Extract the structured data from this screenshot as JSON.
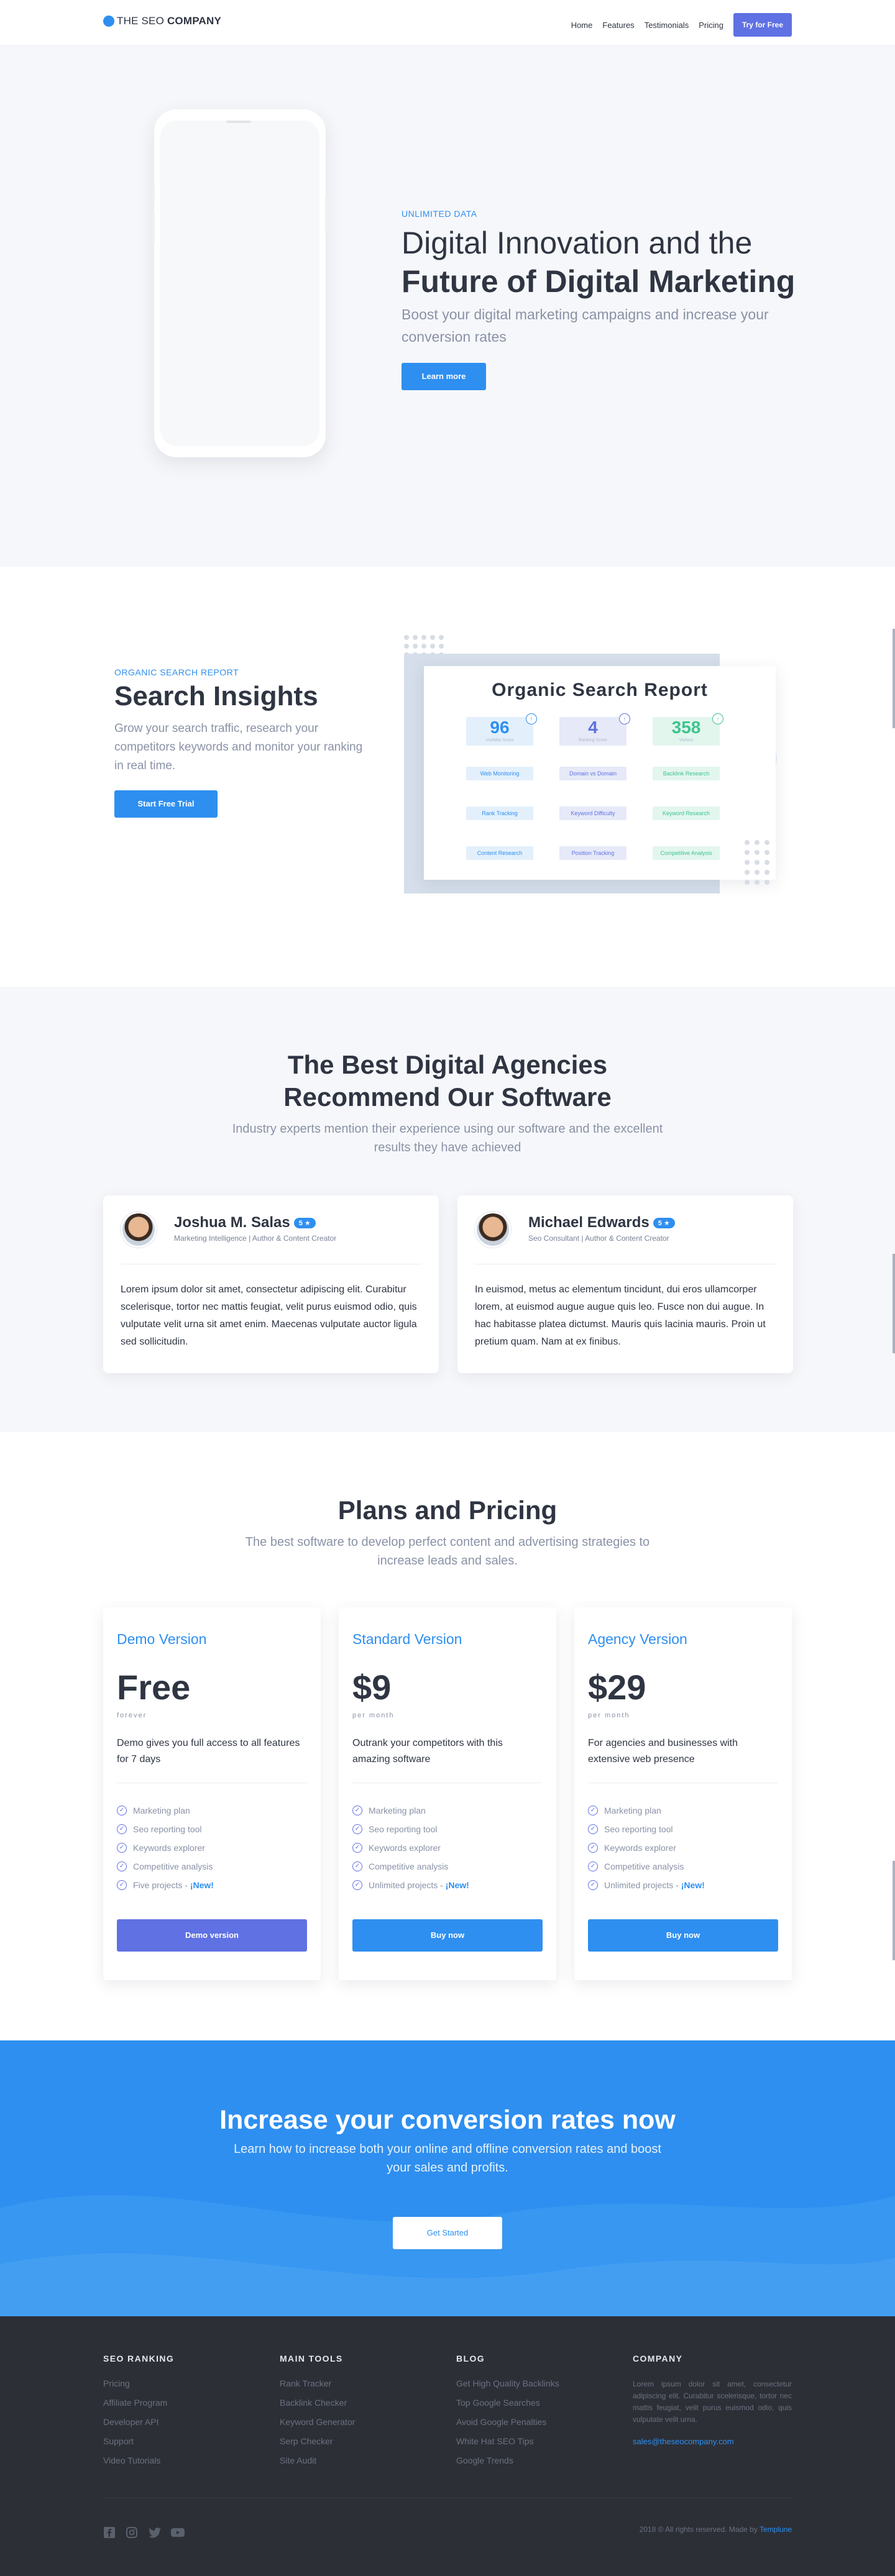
{
  "nav": {
    "logo_pre": "THE SEO ",
    "logo_bold": "COMPANY",
    "links": [
      "Home",
      "Features",
      "Testimonials",
      "Pricing"
    ],
    "cta": "Try for Free"
  },
  "hero": {
    "eyebrow": "UNLIMITED DATA",
    "title_light": "Digital Innovation and the",
    "title_bold": "Future of Digital Marketing",
    "subtitle": "Boost your digital marketing campaigns and increase your conversion rates",
    "button": "Learn more"
  },
  "insights": {
    "eyebrow": "ORGANIC SEARCH REPORT",
    "title": "Search Insights",
    "subtitle": "Grow your search traffic, research your competitors keywords and monitor your ranking in real time.",
    "button": "Start Free Trial",
    "report": {
      "title": "Organic Search Report",
      "stats": [
        {
          "value": "96",
          "label": "Visibility Score",
          "color": "#2e8ff0"
        },
        {
          "value": "4",
          "label": "Ranking Score",
          "color": "#5f71e3"
        },
        {
          "value": "358",
          "label": "Visitors",
          "color": "#3ec48e"
        }
      ],
      "chips": [
        "Web Monitoring",
        "Domain vs Domain",
        "Backlink Research",
        "Rank Tracking",
        "Keyword Difficulty",
        "Keyword Research",
        "Content Research",
        "Position Tracking",
        "Competitive Analysis"
      ]
    }
  },
  "testimonials": {
    "title_line1": "The Best Digital Agencies",
    "title_line2": "Recommend Our Software",
    "subtitle": "Industry experts mention their experience using our software and the excellent results they have achieved",
    "items": [
      {
        "name": "Joshua M. Salas",
        "stars": "5 ★",
        "role": "Marketing Intelligence | Author & Content Creator",
        "quote": "Lorem ipsum dolor sit amet, consectetur adipiscing elit. Curabitur scelerisque, tortor nec mattis feugiat, velit purus euismod odio, quis vulputate velit urna sit amet enim. Maecenas vulputate auctor ligula sed sollicitudin."
      },
      {
        "name": "Michael Edwards",
        "stars": "5 ★",
        "role": "Seo Consultant | Author & Content Creator",
        "quote": "In euismod, metus ac elementum tincidunt, dui eros ullamcorper lorem, at euismod augue augue quis leo. Fusce non dui augue. In hac habitasse platea dictumst. Mauris quis lacinia mauris. Proin ut pretium quam. Nam at ex finibus."
      }
    ]
  },
  "pricing": {
    "title": "Plans and Pricing",
    "subtitle": "The best software to develop perfect content and advertising strategies to increase leads and sales.",
    "plans": [
      {
        "name": "Demo Version",
        "price": "Free",
        "period": "forever",
        "desc": "Demo gives you full access to all features for 7 days",
        "features": [
          "Marketing plan",
          "Seo reporting tool",
          "Keywords explorer",
          "Competitive analysis",
          "Five projects - "
        ],
        "new_label": "¡New!",
        "button": "Demo version",
        "button_color": "#5f71e3"
      },
      {
        "name": "Standard Version",
        "price": "$9",
        "period": "per month",
        "desc": "Outrank your competitors with this amazing software",
        "features": [
          "Marketing plan",
          "Seo reporting tool",
          "Keywords explorer",
          "Competitive analysis",
          "Unlimited projects - "
        ],
        "new_label": "¡New!",
        "button": "Buy now",
        "button_color": "#2e8ff0"
      },
      {
        "name": "Agency Version",
        "price": "$29",
        "period": "per month",
        "desc": "For agencies and businesses with extensive web presence",
        "features": [
          "Marketing plan",
          "Seo reporting tool",
          "Keywords explorer",
          "Competitive analysis",
          "Unlimited projects - "
        ],
        "new_label": "¡New!",
        "button": "Buy now",
        "button_color": "#2e8ff0"
      }
    ]
  },
  "cta": {
    "title": "Increase your conversion rates now",
    "subtitle": "Learn how to increase both your online and offline conversion rates and boost your sales and profits.",
    "button": "Get Started"
  },
  "footer": {
    "columns": [
      {
        "title": "SEO RANKING",
        "links": [
          "Pricing",
          "Affiliate Program",
          "Developer API",
          "Support",
          "Video Tutorials"
        ]
      },
      {
        "title": "MAIN TOOLS",
        "links": [
          "Rank Tracker",
          "Backlink Checker",
          "Keyword Generator",
          "Serp Checker",
          "Site Audit"
        ]
      },
      {
        "title": "BLOG",
        "links": [
          "Get High Quality Backlinks",
          "Top Google Searches",
          "Avoid Google Penalties",
          "White Hat SEO Tips",
          "Google Trends"
        ]
      }
    ],
    "company": {
      "title": "COMPANY",
      "text": "Lorem ipsum dolor sit amet, consectetur adipiscing elit. Curabitur scelerisque, tortor nec mattis feugiat, velit purus euismod odio, quis vulputate velit urna.",
      "email": "sales@theseocompany.com"
    },
    "copyright": "2018 © All rights reserved. Made by ",
    "made_by": "Templune",
    "social_icons": [
      "facebook-icon",
      "instagram-icon",
      "twitter-icon",
      "youtube-icon"
    ]
  },
  "colors": {
    "accent": "#2e8ff0",
    "purple": "#5f71e3",
    "green": "#3ec48e",
    "dark": "#2f3542",
    "footer": "#2c2f36"
  }
}
